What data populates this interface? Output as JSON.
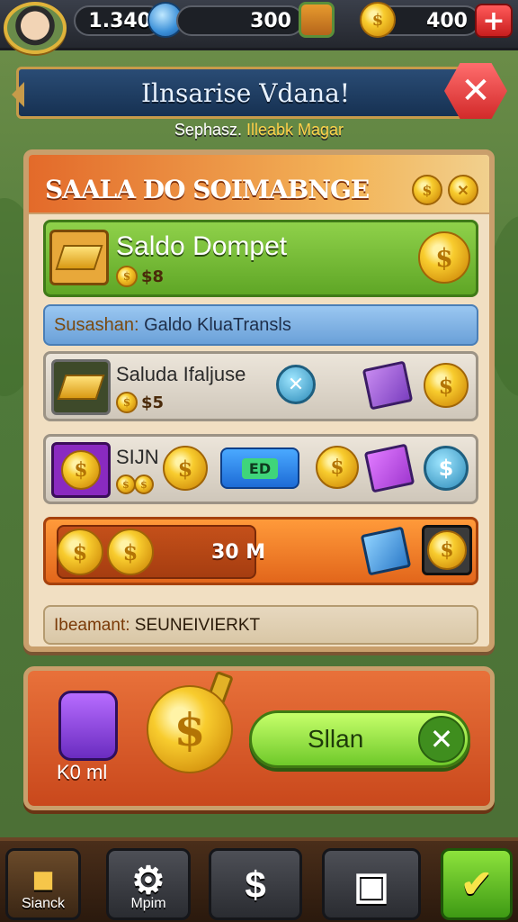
{
  "hud": {
    "player_score": "1.340",
    "gems": "300",
    "coins": "400",
    "add_label": "+"
  },
  "banner": {
    "title": "Ilnsarise Vdana!",
    "close_label": "✕"
  },
  "subtitle": {
    "prefix": "Sephasz.",
    "highlight": "Illeabk Magar"
  },
  "panel": {
    "title": "SAALA DO SOIMABNGE",
    "rows": [
      {
        "label": "Saldo Dompet",
        "sub": "$8"
      },
      {
        "label_key": "Susashan:",
        "label_value": "Galdo KluaTransls"
      },
      {
        "label": "Saluda Ifaljuse",
        "sub": "$5"
      },
      {
        "label": "SIJN",
        "ticket": "ED"
      },
      {
        "amount": "30 M"
      },
      {
        "note_key": "Ibeamant:",
        "note_value": "SEUNEIVIERKT"
      }
    ],
    "dollar_symbol": "$"
  },
  "action": {
    "item_label": "K0 ml",
    "claim_label": "Sllan",
    "cancel_label": "✕"
  },
  "nav": [
    {
      "label": "Sianck",
      "icon": "gold-box-icon"
    },
    {
      "label": "Mpim",
      "icon": "gear-icon"
    },
    {
      "label": "",
      "icon": "dollar-icon"
    },
    {
      "label": "",
      "icon": "camera-icon"
    },
    {
      "label": "",
      "icon": "checkmark-icon"
    }
  ],
  "colors": {
    "accent_green": "#6fc92a",
    "accent_orange": "#e2661b",
    "coin_gold": "#f8cc2e",
    "panel_beige": "#f1dfc2"
  }
}
